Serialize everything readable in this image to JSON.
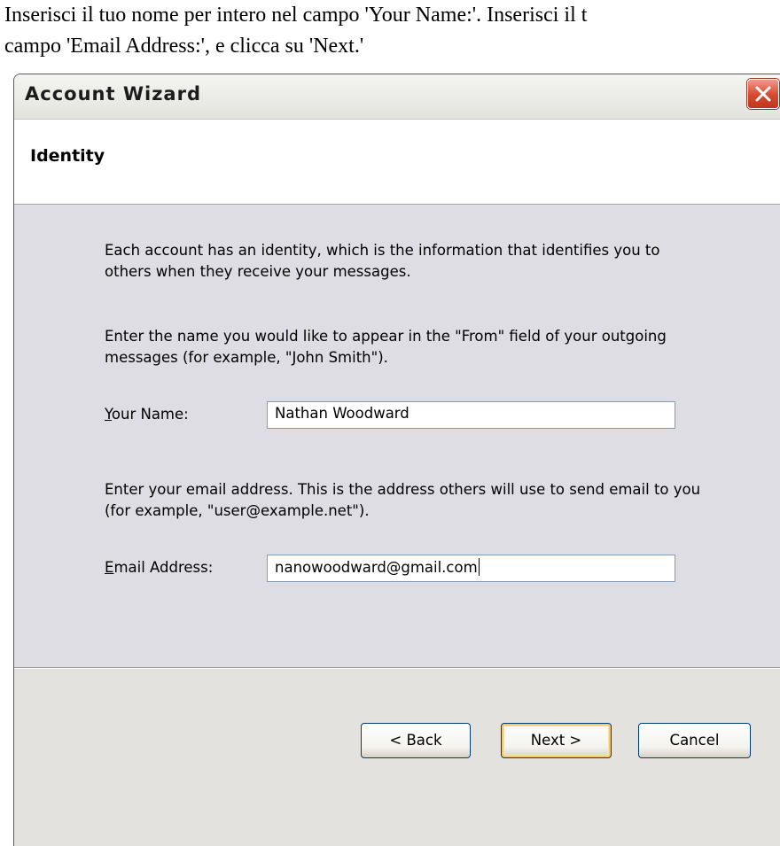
{
  "instruction": {
    "line1": "Inserisci il tuo nome per intero nel campo 'Your Name:'. Inserisci il t",
    "line2": "campo 'Email Address:', e clicca su 'Next.'"
  },
  "window": {
    "title": "Account Wizard",
    "close_icon": "close-icon"
  },
  "header": {
    "title": "Identity"
  },
  "content": {
    "intro": "Each account has an identity, which is the information that identifies you to others when they receive your messages.",
    "name_instruction": "Enter the name you would like to appear in the \"From\" field of your outgoing messages (for example, \"John Smith\").",
    "name_label_accel": "Y",
    "name_label_rest": "our Name:",
    "name_value": "Nathan Woodward",
    "email_instruction": "Enter your email address. This is the address others will use to send email to you (for example, \"user@example.net\").",
    "email_label_accel": "E",
    "email_label_rest": "mail Address:",
    "email_value": "nanowoodward@gmail.com"
  },
  "buttons": {
    "back": "< Back",
    "next": "Next >",
    "cancel": "Cancel"
  },
  "colors": {
    "close_button": "#d5492f",
    "content_bg": "#dedde3",
    "default_button_highlight": "#f5c86a"
  }
}
